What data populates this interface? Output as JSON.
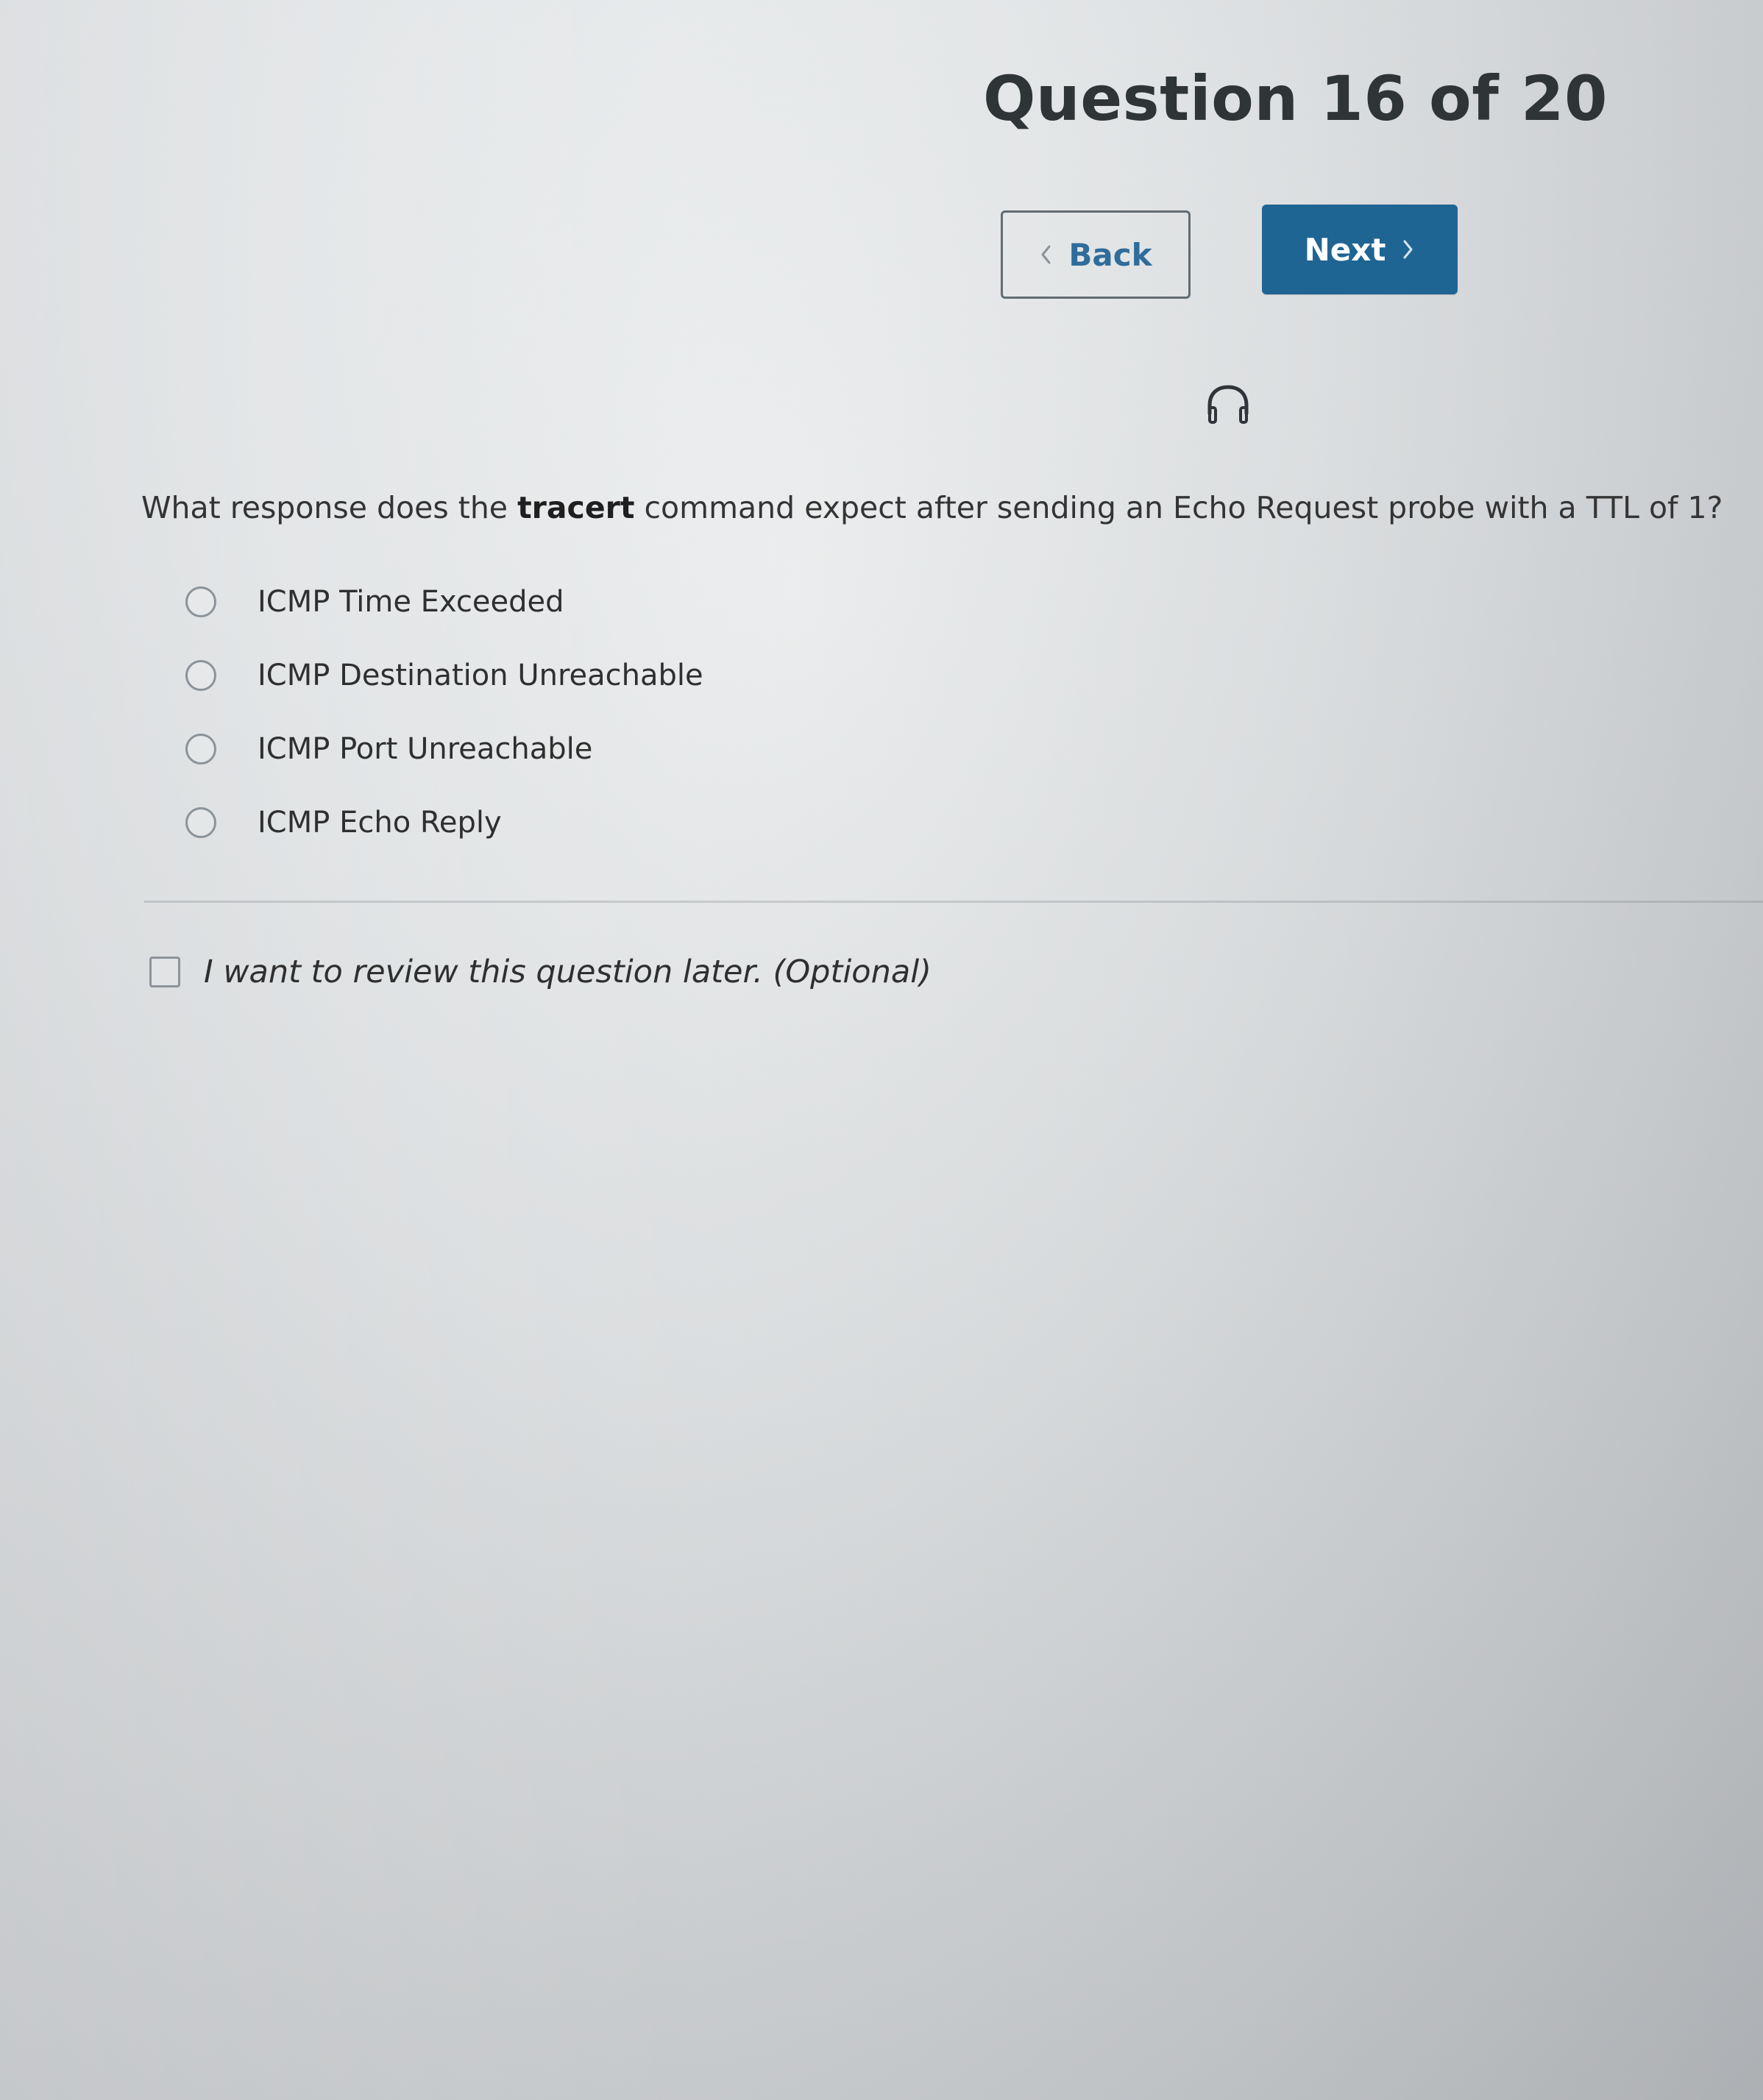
{
  "header": {
    "title": "Question 16 of 20"
  },
  "navigation": {
    "back_label": "Back",
    "next_label": "Next",
    "back_icon": "chevron-left-icon",
    "next_icon": "chevron-right-icon"
  },
  "audio": {
    "icon": "headphones-icon"
  },
  "question": {
    "prefix": "What response does the ",
    "emphasis": "tracert",
    "suffix": " command expect after sending an Echo Request probe with a TTL of 1?",
    "options": [
      {
        "label": "ICMP Time Exceeded"
      },
      {
        "label": "ICMP Destination Unreachable"
      },
      {
        "label": "ICMP Port Unreachable"
      },
      {
        "label": "ICMP Echo Reply"
      }
    ]
  },
  "review": {
    "label": "I want to review this question later. (Optional)"
  },
  "colors": {
    "accent": "#1f6594",
    "link": "#2f6c9b",
    "text": "#2f2f2f"
  }
}
